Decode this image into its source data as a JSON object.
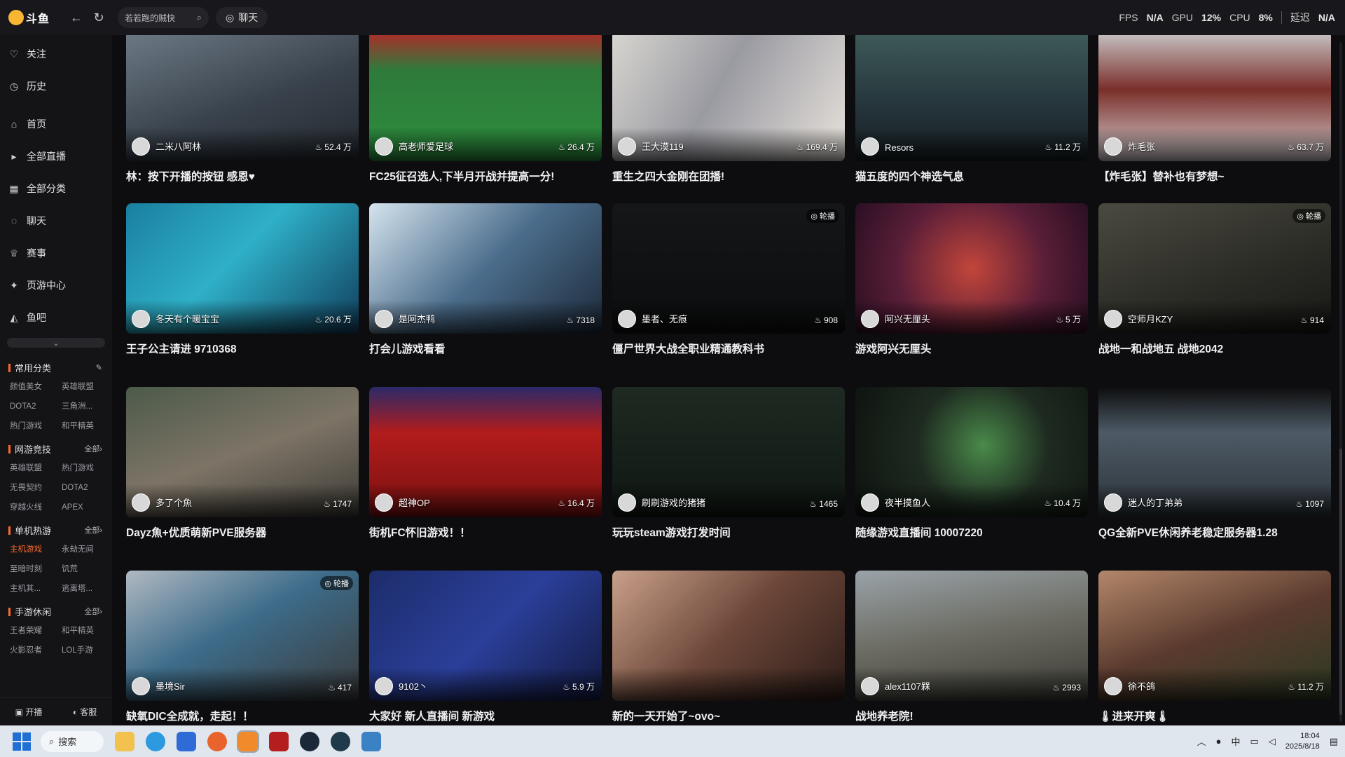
{
  "topbar": {
    "logo_text": "斗鱼",
    "search_value": "若若跑的贼快",
    "chat_label": "聊天",
    "fps_label": "FPS",
    "fps_value": "N/A",
    "gpu_label": "GPU",
    "gpu_value": "12%",
    "cpu_label": "CPU",
    "cpu_value": "8%",
    "latency_label": "延迟",
    "latency_value": "N/A"
  },
  "sidebar": {
    "items": [
      {
        "label": "关注",
        "icon": "heart-icon"
      },
      {
        "label": "历史",
        "icon": "clock-icon"
      },
      {
        "label": "首页",
        "icon": "home-icon"
      },
      {
        "label": "全部直播",
        "icon": "play-icon"
      },
      {
        "label": "全部分类",
        "icon": "grid-icon"
      },
      {
        "label": "聊天",
        "icon": "chat-icon"
      },
      {
        "label": "赛事",
        "icon": "trophy-icon"
      },
      {
        "label": "页游中心",
        "icon": "gamepad-icon"
      },
      {
        "label": "鱼吧",
        "icon": "fish-icon"
      }
    ],
    "common_categories": {
      "title": "常用分类",
      "items": [
        "颜值美女",
        "英雄联盟",
        "DOTA2",
        "三角洲...",
        "热门游戏",
        "和平精英"
      ]
    },
    "online_games": {
      "title": "网游竞技",
      "more": "全部",
      "items": [
        "英雄联盟",
        "热门游戏",
        "无畏契约",
        "DOTA2",
        "穿越火线",
        "APEX"
      ]
    },
    "single_games": {
      "title": "单机热游",
      "more": "全部",
      "items": [
        "主机游戏",
        "永劫无间",
        "至暗时刻",
        "饥荒",
        "主机其...",
        "逃离塔..."
      ]
    },
    "mobile_games": {
      "title": "手游休闲",
      "more": "全部",
      "items": [
        "王者荣耀",
        "和平精英",
        "火影忍者",
        "LOL手游"
      ]
    },
    "bottom": {
      "broadcast": "开播",
      "service": "客服"
    }
  },
  "cards": [
    {
      "anchor": "二米八阿林",
      "viewers": "52.4 万",
      "title": "林：按下开播的按钮 感恩♥",
      "carousel": ""
    },
    {
      "anchor": "高老师爱足球",
      "viewers": "26.4 万",
      "title": "FC25征召选人,下半月开战并提高一分!",
      "carousel": ""
    },
    {
      "anchor": "王大漠119",
      "viewers": "169.4 万",
      "title": "重生之四大金刚在团播!",
      "carousel": ""
    },
    {
      "anchor": "Resors",
      "viewers": "11.2 万",
      "title": "猫五度的四个神选气息",
      "carousel": ""
    },
    {
      "anchor": "炸毛张",
      "viewers": "63.7 万",
      "title": "【炸毛张】替补也有梦想~",
      "carousel": ""
    },
    {
      "anchor": "冬天有个暖宝宝",
      "viewers": "20.6 万",
      "title": "王子公主请进 9710368",
      "carousel": ""
    },
    {
      "anchor": "是阿杰鸭",
      "viewers": "7318",
      "title": "打会儿游戏看看",
      "carousel": ""
    },
    {
      "anchor": "墨者、无痕",
      "viewers": "908",
      "title": "僵尸世界大战全职业精通教科书",
      "carousel": "轮播"
    },
    {
      "anchor": "阿兴无厘头",
      "viewers": "5 万",
      "title": "游戏阿兴无厘头",
      "carousel": ""
    },
    {
      "anchor": "空师月KZY",
      "viewers": "914",
      "title": "战地一和战地五 战地2042",
      "carousel": "轮播"
    },
    {
      "anchor": "多了个魚",
      "viewers": "1747",
      "title": "Dayz魚+优质萌新PVE服务器",
      "carousel": ""
    },
    {
      "anchor": "超神OP",
      "viewers": "16.4 万",
      "title": "街机FC怀旧游戏！！",
      "carousel": ""
    },
    {
      "anchor": "刷刷游戏的猪猪",
      "viewers": "1465",
      "title": "玩玩steam游戏打发时间",
      "carousel": ""
    },
    {
      "anchor": "夜半摸鱼人",
      "viewers": "10.4 万",
      "title": "随缘游戏直播间 10007220",
      "carousel": ""
    },
    {
      "anchor": "迷人的丁弟弟",
      "viewers": "1097",
      "title": "QG全新PVE休闲养老稳定服务器1.28",
      "carousel": ""
    },
    {
      "anchor": "墨境Sir",
      "viewers": "417",
      "title": "缺氧DIC全成就，走起！！",
      "carousel": "轮播"
    },
    {
      "anchor": "9102丶",
      "viewers": "5.9 万",
      "title": "大家好 新人直播间 新游戏",
      "carousel": ""
    },
    {
      "anchor": "",
      "viewers": "",
      "title": "新的一天开始了~ovo~",
      "carousel": ""
    },
    {
      "anchor": "alex1107槑",
      "viewers": "2993",
      "title": "战地养老院!",
      "carousel": ""
    },
    {
      "anchor": "徐不鸽",
      "viewers": "11.2 万",
      "title": "🌡进来开爽🌡",
      "carousel": ""
    }
  ],
  "taskbar": {
    "search_label": "搜索",
    "time": "18:04",
    "date": "2025/8/18"
  }
}
